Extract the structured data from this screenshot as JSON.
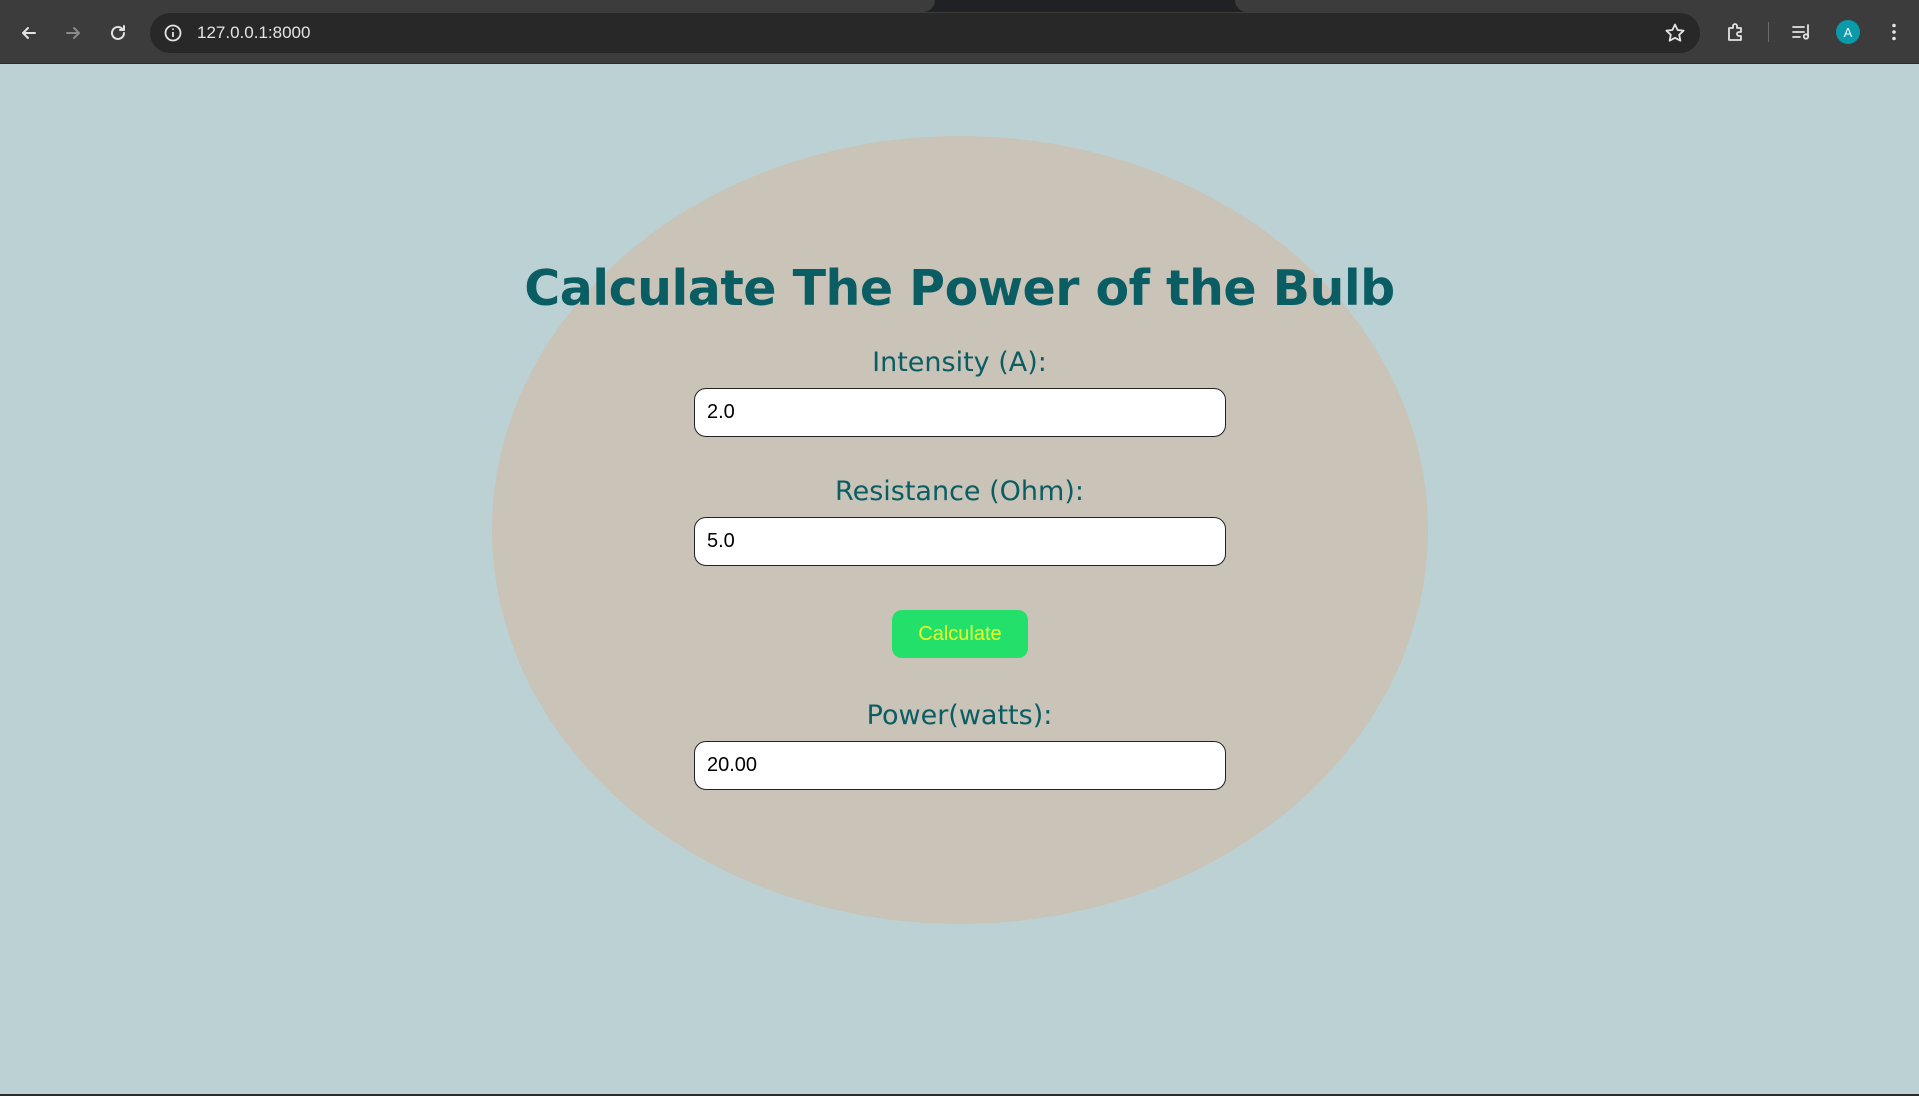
{
  "browser": {
    "url": "127.0.0.1:8000",
    "avatar_letter": "A",
    "icons": {
      "back": "back-arrow-icon",
      "forward": "forward-arrow-icon",
      "reload": "reload-icon",
      "info": "site-info-icon",
      "bookmark": "star-icon",
      "extensions": "puzzle-icon",
      "media": "media-queue-icon",
      "menu": "kebab-menu-icon"
    }
  },
  "page": {
    "title": "Calculate The Power of the Bulb",
    "intensity": {
      "label": "Intensity (A):",
      "value": "2.0"
    },
    "resistance": {
      "label": "Resistance (Ohm):",
      "value": "5.0"
    },
    "calculate_label": "Calculate",
    "power": {
      "label": "Power(watts):",
      "value": "20.00"
    }
  },
  "colors": {
    "page_background": "#bcd1d4",
    "ellipse_background": "#c9c3b8",
    "text_teal": "#0a5d63",
    "button_green": "#22e06a",
    "button_text_yellow": "#ecff27"
  }
}
